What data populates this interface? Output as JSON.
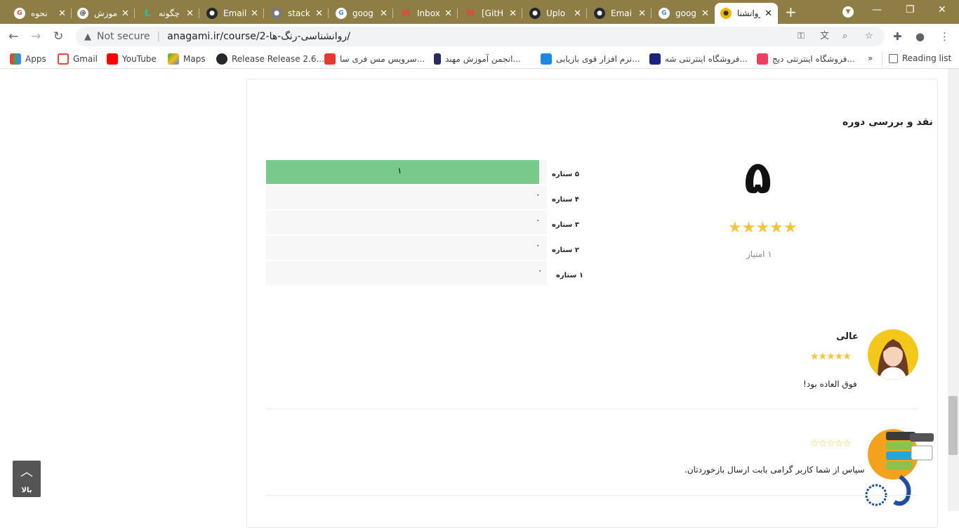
{
  "browser": {
    "tabs": [
      {
        "title": "نحوه",
        "icon": "google-icon",
        "color": "#ea4335"
      },
      {
        "title": "آموزش",
        "icon": "threads-icon",
        "color": "#222222"
      },
      {
        "title": "چگونه",
        "icon": "site-icon",
        "color": "#21c2a7"
      },
      {
        "title": "Email",
        "icon": "github-icon",
        "color": "#24292e"
      },
      {
        "title": "stack",
        "icon": "globe-icon",
        "color": "#7a7a7a"
      },
      {
        "title": "goog",
        "icon": "google-icon",
        "color": "#4285f4"
      },
      {
        "title": "Inbox",
        "icon": "gmail-icon",
        "color": "#ea4335"
      },
      {
        "title": "[GitH",
        "icon": "gmail-icon",
        "color": "#ea4335"
      },
      {
        "title": "Uplo",
        "icon": "github-icon",
        "color": "#24292e"
      },
      {
        "title": "Emai",
        "icon": "github-icon",
        "color": "#24292e"
      },
      {
        "title": "goog",
        "icon": "google-icon",
        "color": "#4285f4"
      },
      {
        "title": "روانشنا",
        "icon": "bee-icon",
        "color": "#f4b400",
        "active": true
      }
    ],
    "new_tab": "+",
    "address": {
      "warning": "Not secure",
      "url": "anagami.ir/course/2-روانشناسی-رنگ-ها/"
    },
    "bookmarks": [
      {
        "label": "Apps",
        "color": "#4285f4"
      },
      {
        "label": "Gmail",
        "color": "#ea4335"
      },
      {
        "label": "YouTube",
        "color": "#ff0000"
      },
      {
        "label": "Maps",
        "color": "#34a853"
      },
      {
        "label": "Release Release 2.6....",
        "color": "#24292e"
      },
      {
        "label": "سرویس مس فری سا...",
        "color": "#e53935"
      },
      {
        "label": "انجمن آموزش مهند...",
        "color": "#2b2b5c"
      },
      {
        "label": "نرم افزار قوی بازیابی...",
        "color": "#1e88e5"
      },
      {
        "label": "فروشگاه اینترنتی شه...",
        "color": "#1a237e"
      },
      {
        "label": "فروشگاه اینترنتی دیج...",
        "color": "#ef3f5e"
      },
      {
        "label": "»",
        "color": ""
      },
      {
        "label": "Reading list",
        "color": "#5f6368"
      }
    ]
  },
  "reviews_section": {
    "title": "نقد و بررسی دوره",
    "average": "۵",
    "votes": "۱ امتیاز",
    "stars_full": "★★★★★",
    "breakdown": [
      {
        "label": "۵ ستاره",
        "count": "۱",
        "fraction": 1.0
      },
      {
        "label": "۴ ستاره",
        "count": "۰",
        "fraction": 0
      },
      {
        "label": "۳ ستاره",
        "count": "۰",
        "fraction": 0
      },
      {
        "label": "۲ ستاره",
        "count": "۰",
        "fraction": 0
      },
      {
        "label": "۱ ستاره",
        "count": "۰",
        "fraction": 0
      }
    ],
    "comments": [
      {
        "title": "عالی",
        "stars": "★★★★★",
        "text": "فوق العاده بود!",
        "rating": 5
      },
      {
        "title": "",
        "stars": "☆☆☆☆☆",
        "text": "سپاس از شما کاربر گرامی بابت ارسال بازخوردتان.",
        "rating": 0
      }
    ]
  },
  "back_to_top": {
    "icon": "chevron-up-icon",
    "label": "بالا"
  },
  "colors": {
    "bar_fill": "#78c98a",
    "star": "#f6c33b",
    "tabstrip": "#8e7e45"
  }
}
